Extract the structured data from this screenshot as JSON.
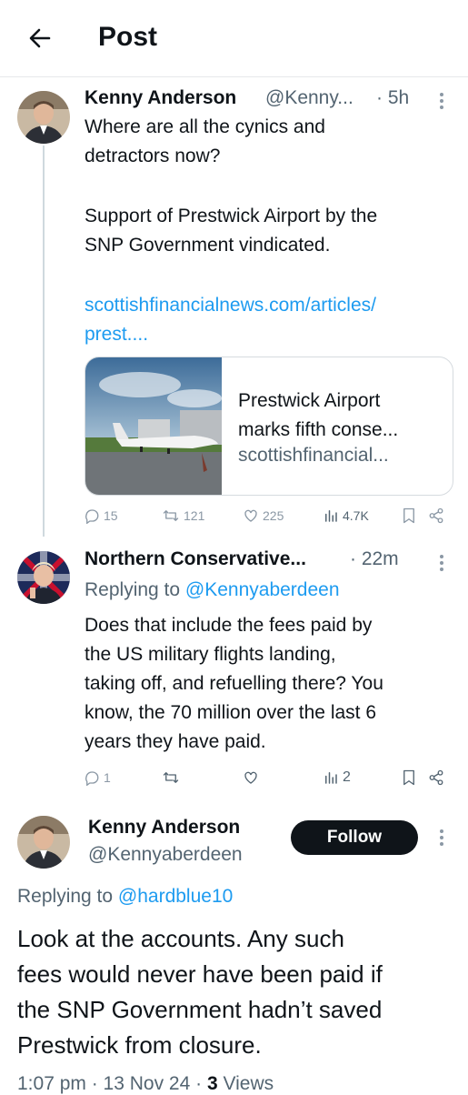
{
  "header": {
    "title": "Post"
  },
  "tweet1": {
    "name": "Kenny Anderson",
    "handle": "@Kenny...",
    "time": "· 5h",
    "line1": "Where are all the cynics and",
    "line2": "detractors now?",
    "line3": "Support of Prestwick Airport by the",
    "line4": "SNP Government vindicated.",
    "link1": "scottishfinancialnews.com/articles/",
    "link2": "prest....",
    "card": {
      "title1": "Prestwick Airport",
      "title2": "marks fifth conse...",
      "domain": "scottishfinancial..."
    },
    "stats": {
      "replies": "15",
      "reposts": "121",
      "likes": "225",
      "views": "4.7K"
    }
  },
  "tweet2": {
    "name": "Northern Conservative...",
    "time": "· 22m",
    "replying_prefix": "Replying to",
    "replying_handle": "@Kennyaberdeen",
    "line1": "Does that include the fees paid by",
    "line2": "the US military flights landing,",
    "line3": "taking off, and refuelling there? You",
    "line4": "know, the 70 million over the last 6",
    "line5": "years they have paid.",
    "stats": {
      "replies": "1",
      "reposts": "",
      "likes": "",
      "views": "2"
    }
  },
  "main_tweet": {
    "name": "Kenny Anderson",
    "handle": "@Kennyaberdeen",
    "follow_label": "Follow",
    "replying_prefix": "Replying to",
    "replying_handle": "@hardblue10",
    "line1": "Look at the accounts. Any such",
    "line2": "fees would never have been paid if",
    "line3": "the SNP Government hadn’t saved",
    "line4": "Prestwick from closure.",
    "footer_time": "1:07 pm · 13 Nov 24 ·",
    "footer_views_count": "3",
    "footer_views_label": "Views"
  },
  "colors": {
    "link": "#1d9bf0",
    "text": "#0f1419",
    "muted": "#536471",
    "button": "#0f1419"
  }
}
